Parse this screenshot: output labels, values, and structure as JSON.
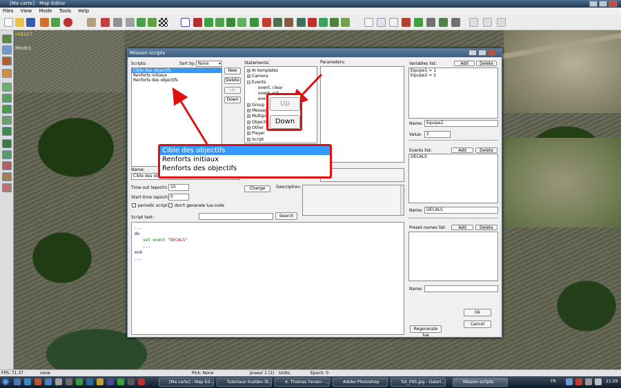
{
  "app": {
    "title": "[Ma carte] - Map Editor",
    "menu": [
      "Files",
      "View",
      "Mode",
      "Tools",
      "Help"
    ]
  },
  "hud": {
    "code": "r48307",
    "mode": "Mode1"
  },
  "dialog": {
    "title": "Mission scripts",
    "scripts_label": "Scripts:",
    "sortby_label": "Sort by:",
    "sortby_value": "None",
    "scripts": [
      "Cible des objectifs",
      "Renforts initiaux",
      "Renforts des objectifs"
    ],
    "buttons": {
      "new": "New",
      "delete": "Delete",
      "up": "Up",
      "down": "Down"
    },
    "statements_label": "Statements:",
    "statements": [
      {
        "label": "AI templates",
        "expander": "+",
        "indent": 0
      },
      {
        "label": "Camera",
        "expander": "+",
        "indent": 0
      },
      {
        "label": "Events",
        "expander": "−",
        "indent": 0
      },
      {
        "label": "event, clear",
        "expander": "",
        "indent": 1
      },
      {
        "label": "event, set",
        "expander": "",
        "indent": 1
      },
      {
        "label": "eve",
        "expander": "",
        "indent": 1
      },
      {
        "label": "Group",
        "expander": "+",
        "indent": 0
      },
      {
        "label": "Messag",
        "expander": "+",
        "indent": 0
      },
      {
        "label": "Multipla",
        "expander": "+",
        "indent": 0
      },
      {
        "label": "Objectiv",
        "expander": "+",
        "indent": 0
      },
      {
        "label": "Other",
        "expander": "+",
        "indent": 0
      },
      {
        "label": "Player",
        "expander": "+",
        "indent": 0
      },
      {
        "label": "Script",
        "expander": "+",
        "indent": 0
      }
    ],
    "parameters_label": "Parameters:",
    "name_label": "Name:",
    "name_value": "Cible des objecti",
    "timeout_label": "Time out (epoch):",
    "timeout_value": "10",
    "starttime_label": "Start time (epoch):",
    "starttime_value": "0",
    "periodic_label": "periodic script",
    "nolua_label": "don't generate lua-code",
    "change_label": "Change",
    "description_label": "Description:",
    "scripttext_label": "Script text:",
    "search_label": "Search",
    "code_lines": [
      {
        "text": "...",
        "color": "#000080",
        "indent": 0
      },
      {
        "text": "do",
        "color": "#000080",
        "indent": 0
      },
      {
        "text": "set event ",
        "color": "#008000",
        "indent": 1,
        "string": "\"DECALS\""
      },
      {
        "text": "...",
        "color": "#000080",
        "indent": 1
      },
      {
        "text": "end",
        "color": "#000080",
        "indent": 0
      },
      {
        "text": "...",
        "color": "#000080",
        "indent": 0
      }
    ],
    "variables_label": "Variables list:",
    "variables": [
      "Equipe1 = 1",
      "Equipe2 = 2"
    ],
    "add_label": "Add",
    "delete_label": "Delete",
    "var_name_label": "Name:",
    "var_name_value": "Equipe2",
    "var_value_label": "Value:",
    "var_value_value": "2",
    "events_label": "Events list:",
    "events": [
      "DECALS"
    ],
    "event_name_label": "Name:",
    "event_name_value": "DECALS",
    "preset_label": "Preset names list:",
    "preset_name_label": "Name:",
    "ok_label": "Ok",
    "cancel_label": "Cancel",
    "regenerate_label": "Regenerate lua"
  },
  "callout": {
    "list": [
      "Cible des objectifs",
      "Renforts initiaux",
      "Renforts des objectifs"
    ],
    "up": "Up",
    "down": "Down",
    "color": "#e01010"
  },
  "status": {
    "fps": "FPS: 71.37",
    "none1": "none",
    "pick": "Pick: None",
    "player": "Joueur 1 (1)",
    "units": "Units:",
    "epoch": "Epoch: 0"
  },
  "taskbar": {
    "tasks": [
      "[Ma carte] - Map Ed...",
      "Tutoriaux Sudden St...",
      "4. Thomas Fersen - ...",
      "Adobe Photoshop",
      "Tut_095.jpg - Galeri...",
      "Mission scripts"
    ],
    "lang": "FR",
    "clock": "21:29"
  }
}
